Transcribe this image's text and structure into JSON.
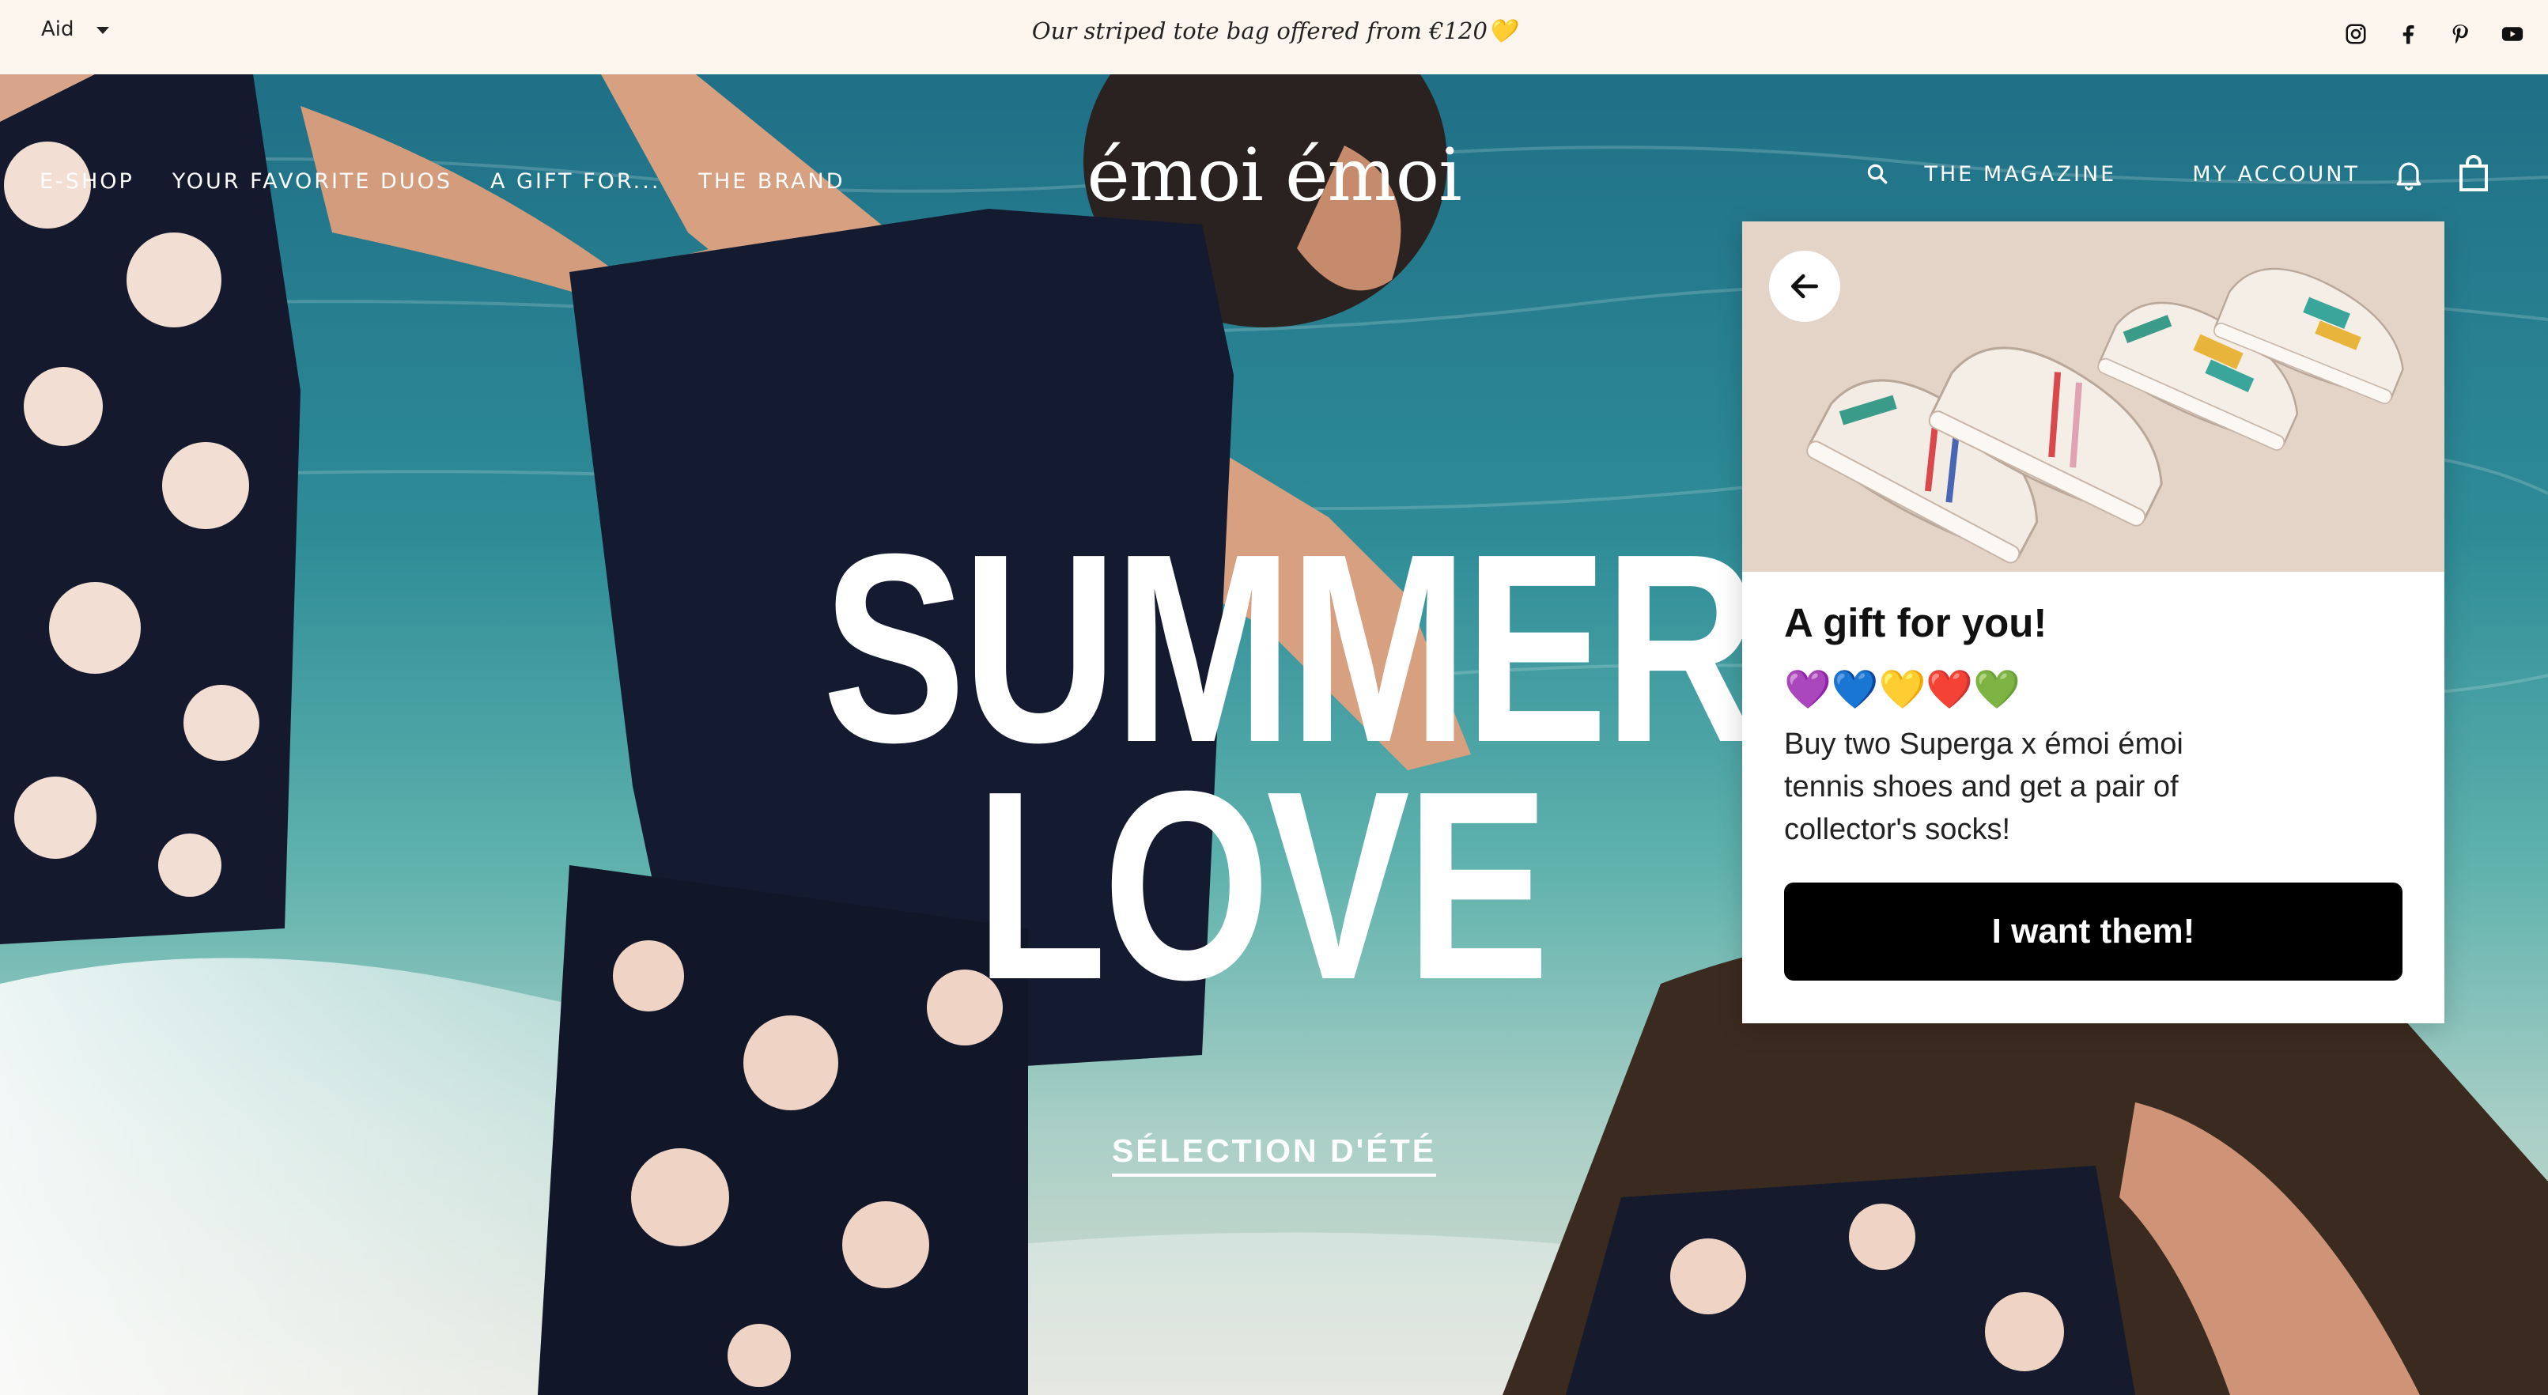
{
  "announcement": {
    "language": "Aid",
    "promo": "Our striped tote bag offered from €120💛",
    "socials": [
      "instagram-icon",
      "facebook-icon",
      "pinterest-icon",
      "youtube-icon"
    ]
  },
  "header": {
    "logo": "émoi émoi",
    "nav_left": [
      "E-SHOP",
      "YOUR FAVORITE DUOS",
      "A GIFT FOR...",
      "THE BRAND"
    ],
    "magazine": "THE MAGAZINE",
    "account": "MY ACCOUNT"
  },
  "hero": {
    "line1": "SUMMER",
    "line2": "LOVE",
    "cta": "SÉLECTION D'ÉTÉ"
  },
  "popup": {
    "title": "A gift for you!",
    "hearts": "💜💙💛❤️💚",
    "body": "Buy two Superga x émoi émoi tennis shoes and get a pair of collector's socks!",
    "button": "I want them!"
  },
  "colors": {
    "announce_bg": "#fdf6ef",
    "button_bg": "#000000",
    "sea": "#3f8f9a"
  }
}
